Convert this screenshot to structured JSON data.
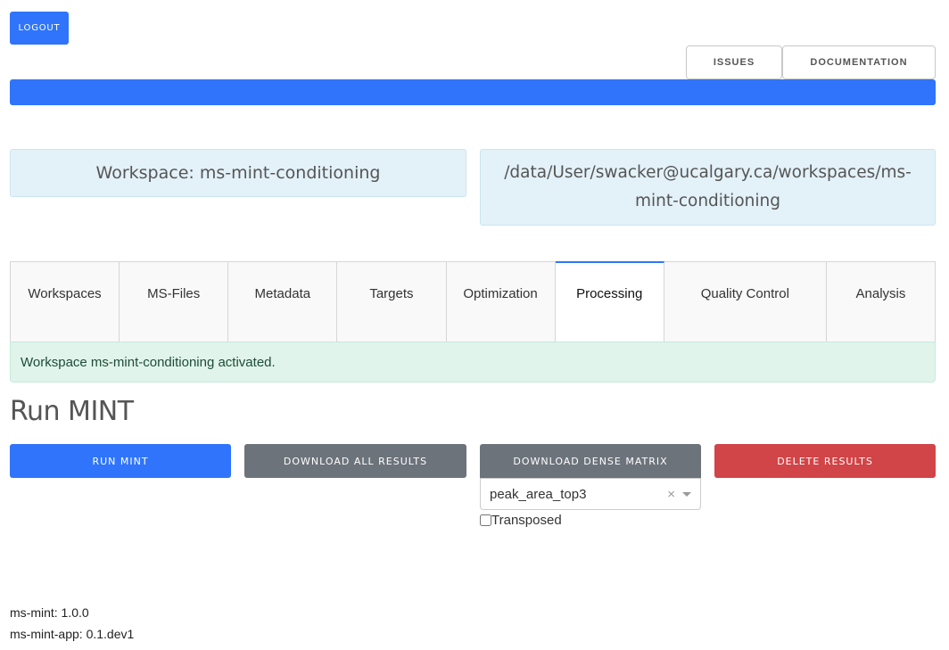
{
  "header": {
    "logout_label": "LOGOUT",
    "issues_label": "ISSUES",
    "documentation_label": "DOCUMENTATION"
  },
  "workspace": {
    "name_label": "Workspace: ms-mint-conditioning",
    "path": "/data/User/swacker@ucalgary.ca/workspaces/ms-mint-conditioning"
  },
  "tabs": [
    {
      "label": "Workspaces",
      "active": false
    },
    {
      "label": "MS-Files",
      "active": false
    },
    {
      "label": "Metadata",
      "active": false
    },
    {
      "label": "Targets",
      "active": false
    },
    {
      "label": "Optimization",
      "active": false
    },
    {
      "label": "Processing",
      "active": true
    },
    {
      "label": "Quality Control",
      "active": false
    },
    {
      "label": "Analysis",
      "active": false
    }
  ],
  "alert": {
    "message": "Workspace ms-mint-conditioning activated."
  },
  "processing": {
    "title": "Run MINT",
    "run_label": "RUN MINT",
    "download_all_label": "DOWNLOAD ALL RESULTS",
    "download_dense_label": "DOWNLOAD DENSE MATRIX",
    "delete_label": "DELETE RESULTS",
    "matrix_select": {
      "value": "peak_area_top3",
      "clear_glyph": "×"
    },
    "transposed": {
      "label": "Transposed",
      "checked": false
    }
  },
  "versions": {
    "ms_mint": "ms-mint: 1.0.0",
    "ms_mint_app": "ms-mint-app: 0.1.dev1"
  },
  "colors": {
    "primary": "#2f74fb",
    "secondary": "#6c737b",
    "danger": "#d14447",
    "info_bg": "#e3f1f8",
    "success_bg": "#e0f4ec"
  }
}
